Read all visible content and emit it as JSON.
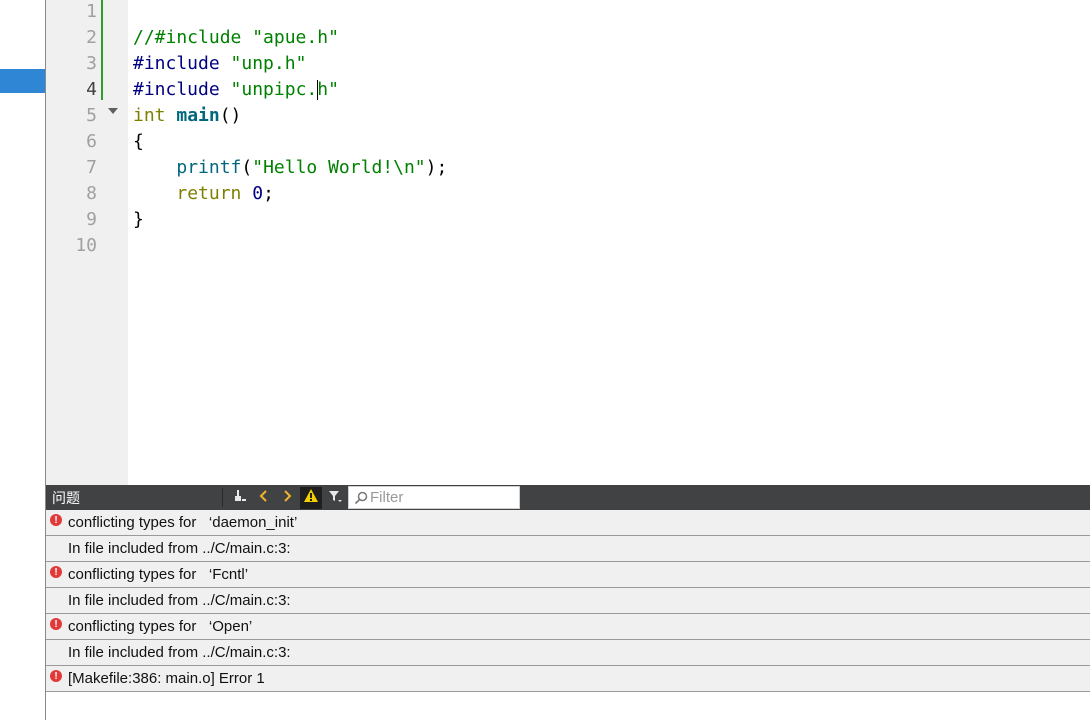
{
  "editor": {
    "current_line": 4,
    "line_numbers": [
      "1",
      "2",
      "3",
      "4",
      "5",
      "6",
      "7",
      "8",
      "9",
      "10"
    ],
    "code": {
      "l2": "//#include \"apue.h\"",
      "l3_directive": "#include",
      "l3_str": "\"unp.h\"",
      "l4_directive": "#include",
      "l4_str_pre": "\"unpipc.",
      "l4_str_post": "h\"",
      "l5_type": "int",
      "l5_name": "main",
      "l5_parens": "()",
      "l6": "{",
      "l7_fn": "printf",
      "l7_open": "(",
      "l7_str": "\"Hello World!\\n\"",
      "l7_close": ");",
      "l8_kw": "return",
      "l8_num": "0",
      "l8_semi": ";",
      "l9": "}"
    }
  },
  "issues_panel": {
    "title": "问题",
    "filter_placeholder": "Filter",
    "items": [
      {
        "severity": "error",
        "text": "conflicting types for   ‘daemon_init’"
      },
      {
        "severity": "none",
        "text": "In file included from ../C/main.c:3:"
      },
      {
        "severity": "error",
        "text": "conflicting types for   ‘Fcntl’"
      },
      {
        "severity": "none",
        "text": "In file included from ../C/main.c:3:"
      },
      {
        "severity": "error",
        "text": "conflicting types for   ‘Open’"
      },
      {
        "severity": "none",
        "text": "In file included from ../C/main.c:3:"
      },
      {
        "severity": "error",
        "text": "[Makefile:386: main.o] Error 1"
      }
    ]
  },
  "colors": {
    "gutter_bg": "#f0f0f0",
    "change_bar": "#2e9c2e",
    "toolbar_bg": "#404244",
    "error_icon": "#e23a3a",
    "selection_blue": "#2f86d4"
  },
  "icons": {
    "clean": "broom-icon",
    "prev": "chevron-left-icon",
    "next": "chevron-right-icon",
    "warnings": "warning-triangle-icon",
    "filter": "filter-icon",
    "search": "magnifier-icon",
    "error": "error-circle-icon"
  }
}
